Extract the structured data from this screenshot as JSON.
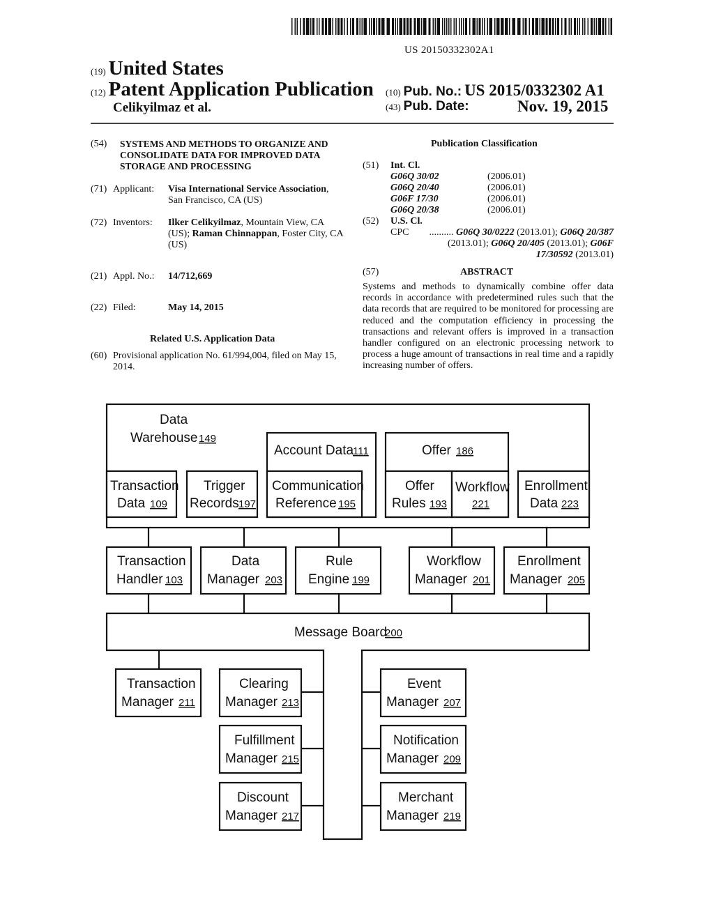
{
  "header": {
    "barcode_text": "US 20150332302A1",
    "country_code": "(19)",
    "country": "United States",
    "type_code": "(12)",
    "type": "Patent Application Publication",
    "authors": "Celikyilmaz et al.",
    "pub_no_code": "(10)",
    "pub_no_label": "Pub. No.:",
    "pub_no": "US 2015/0332302 A1",
    "pub_date_code": "(43)",
    "pub_date_label": "Pub. Date:",
    "pub_date": "Nov. 19, 2015"
  },
  "biblio": {
    "title_code": "(54)",
    "title": "SYSTEMS AND METHODS TO ORGANIZE AND CONSOLIDATE DATA FOR IMPROVED DATA STORAGE AND PROCESSING",
    "applicant_code": "(71)",
    "applicant_label": "Applicant:",
    "applicant_name": "Visa International Service Association",
    "applicant_loc": "San Francisco, CA (US)",
    "inventors_code": "(72)",
    "inventors_label": "Inventors:",
    "inventor1": "Ilker Celikyilmaz",
    "inventor1_loc": ", Mountain View, CA (US); ",
    "inventor2": "Raman Chinnappan",
    "inventor2_loc": ", Foster City, CA (US)",
    "appl_code": "(21)",
    "appl_label": "Appl. No.:",
    "appl_no": "14/712,669",
    "filed_code": "(22)",
    "filed_label": "Filed:",
    "filed_date": "May 14, 2015",
    "related_heading": "Related U.S. Application Data",
    "prov_code": "(60)",
    "prov_text": "Provisional application No. 61/994,004, filed on May 15, 2014."
  },
  "classification": {
    "heading": "Publication Classification",
    "int_code": "(51)",
    "int_label": "Int. Cl.",
    "int_cl": [
      {
        "code": "G06Q 30/02",
        "version": "(2006.01)"
      },
      {
        "code": "G06Q 20/40",
        "version": "(2006.01)"
      },
      {
        "code": "G06F 17/30",
        "version": "(2006.01)"
      },
      {
        "code": "G06Q 20/38",
        "version": "(2006.01)"
      }
    ],
    "us_code": "(52)",
    "us_label": "U.S. Cl.",
    "cpc_label": "CPC",
    "cpc_dots": "..........",
    "cpc": [
      {
        "code": "G06Q 30/0222",
        "version": "(2013.01)"
      },
      {
        "code": "G06Q 20/387",
        "version": "(2013.01)"
      },
      {
        "code": "G06Q 20/405",
        "version": "(2013.01)"
      },
      {
        "code": "G06F 17/30592",
        "version": "(2013.01)"
      }
    ]
  },
  "abstract": {
    "code": "(57)",
    "heading": "ABSTRACT",
    "text": "Systems and methods to dynamically combine offer data records in accordance with predetermined rules such that the data records that are required to be monitored for processing are reduced and the computation efficiency in processing the transactions and relevant offers is improved in a transaction handler configured on an electronic processing network to process a huge amount of transactions in real time and a rapidly increasing number of offers."
  },
  "diagram": {
    "warehouse": {
      "line1": "Data",
      "line2": "Warehouse",
      "ref": "149"
    },
    "account_data": {
      "label": "Account Data",
      "ref": "111"
    },
    "offer": {
      "label": "Offer",
      "ref": "186"
    },
    "transaction_data": {
      "line1": "Transaction",
      "line2": "Data",
      "ref": "109"
    },
    "trigger_records": {
      "line1": "Trigger",
      "line2": "Records",
      "ref": "197"
    },
    "comm_reference": {
      "line1": "Communication",
      "line2": "Reference",
      "ref": "195"
    },
    "offer_rules": {
      "line1": "Offer",
      "line2": "Rules",
      "ref": "193"
    },
    "workflow": {
      "line1": "Workflow",
      "ref": "221"
    },
    "enrollment_data": {
      "line1": "Enrollment",
      "line2": "Data",
      "ref": "223"
    },
    "transaction_handler": {
      "line1": "Transaction",
      "line2": "Handler",
      "ref": "103"
    },
    "data_manager": {
      "line1": "Data",
      "line2": "Manager",
      "ref": "203"
    },
    "rule_engine": {
      "line1": "Rule",
      "line2": "Engine",
      "ref": "199"
    },
    "workflow_manager": {
      "line1": "Workflow",
      "line2": "Manager",
      "ref": "201"
    },
    "enrollment_manager": {
      "line1": "Enrollment",
      "line2": "Manager",
      "ref": "205"
    },
    "message_board": {
      "label": "Message Board",
      "ref": "200"
    },
    "transaction_manager": {
      "line1": "Transaction",
      "line2": "Manager",
      "ref": "211"
    },
    "clearing_manager": {
      "line1": "Clearing",
      "line2": "Manager",
      "ref": "213"
    },
    "fulfillment_manager": {
      "line1": "Fulfillment",
      "line2": "Manager",
      "ref": "215"
    },
    "discount_manager": {
      "line1": "Discount",
      "line2": "Manager",
      "ref": "217"
    },
    "event_manager": {
      "line1": "Event",
      "line2": "Manager",
      "ref": "207"
    },
    "notification_manager": {
      "line1": "Notification",
      "line2": "Manager",
      "ref": "209"
    },
    "merchant_manager": {
      "line1": "Merchant",
      "line2": "Manager",
      "ref": "219"
    }
  }
}
